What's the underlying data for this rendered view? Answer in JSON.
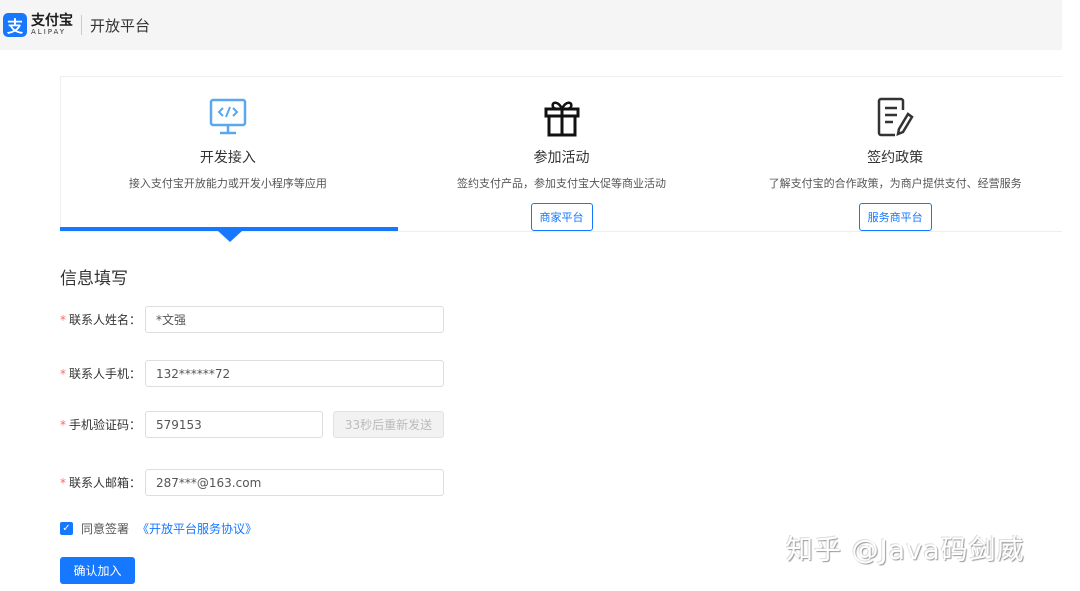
{
  "header": {
    "logo_glyph": "支",
    "logo_cn": "支付宝",
    "logo_en": "ALIPAY",
    "platform": "开放平台"
  },
  "cards": [
    {
      "icon": "code-monitor-icon",
      "title": "开发接入",
      "desc": "接入支付宝开放能力或开发小程序等应用",
      "active": true
    },
    {
      "icon": "gift-icon",
      "title": "参加活动",
      "desc": "签约支付产品，参加支付宝大促等商业活动",
      "button": "商家平台"
    },
    {
      "icon": "document-edit-icon",
      "title": "签约政策",
      "desc": "了解支付宝的合作政策，为商户提供支付、经营服务",
      "button": "服务商平台"
    }
  ],
  "form": {
    "section_title": "信息填写",
    "required_mark": "*",
    "fields": [
      {
        "label": "联系人姓名：",
        "value": "*文强"
      },
      {
        "label": "联系人手机：",
        "value": "132******72"
      },
      {
        "label": "手机验证码：",
        "value": "579153",
        "action": "33秒后重新发送"
      },
      {
        "label": "联系人邮箱：",
        "value": "287***@163.com"
      }
    ],
    "agree_checked": true,
    "agree_text": "同意签署",
    "agree_link": "《开放平台服务协议》",
    "submit": "确认加入"
  },
  "watermark": "知乎 @Java码剑威",
  "colors": {
    "accent": "#1677ff",
    "required": "#f56c6c"
  }
}
